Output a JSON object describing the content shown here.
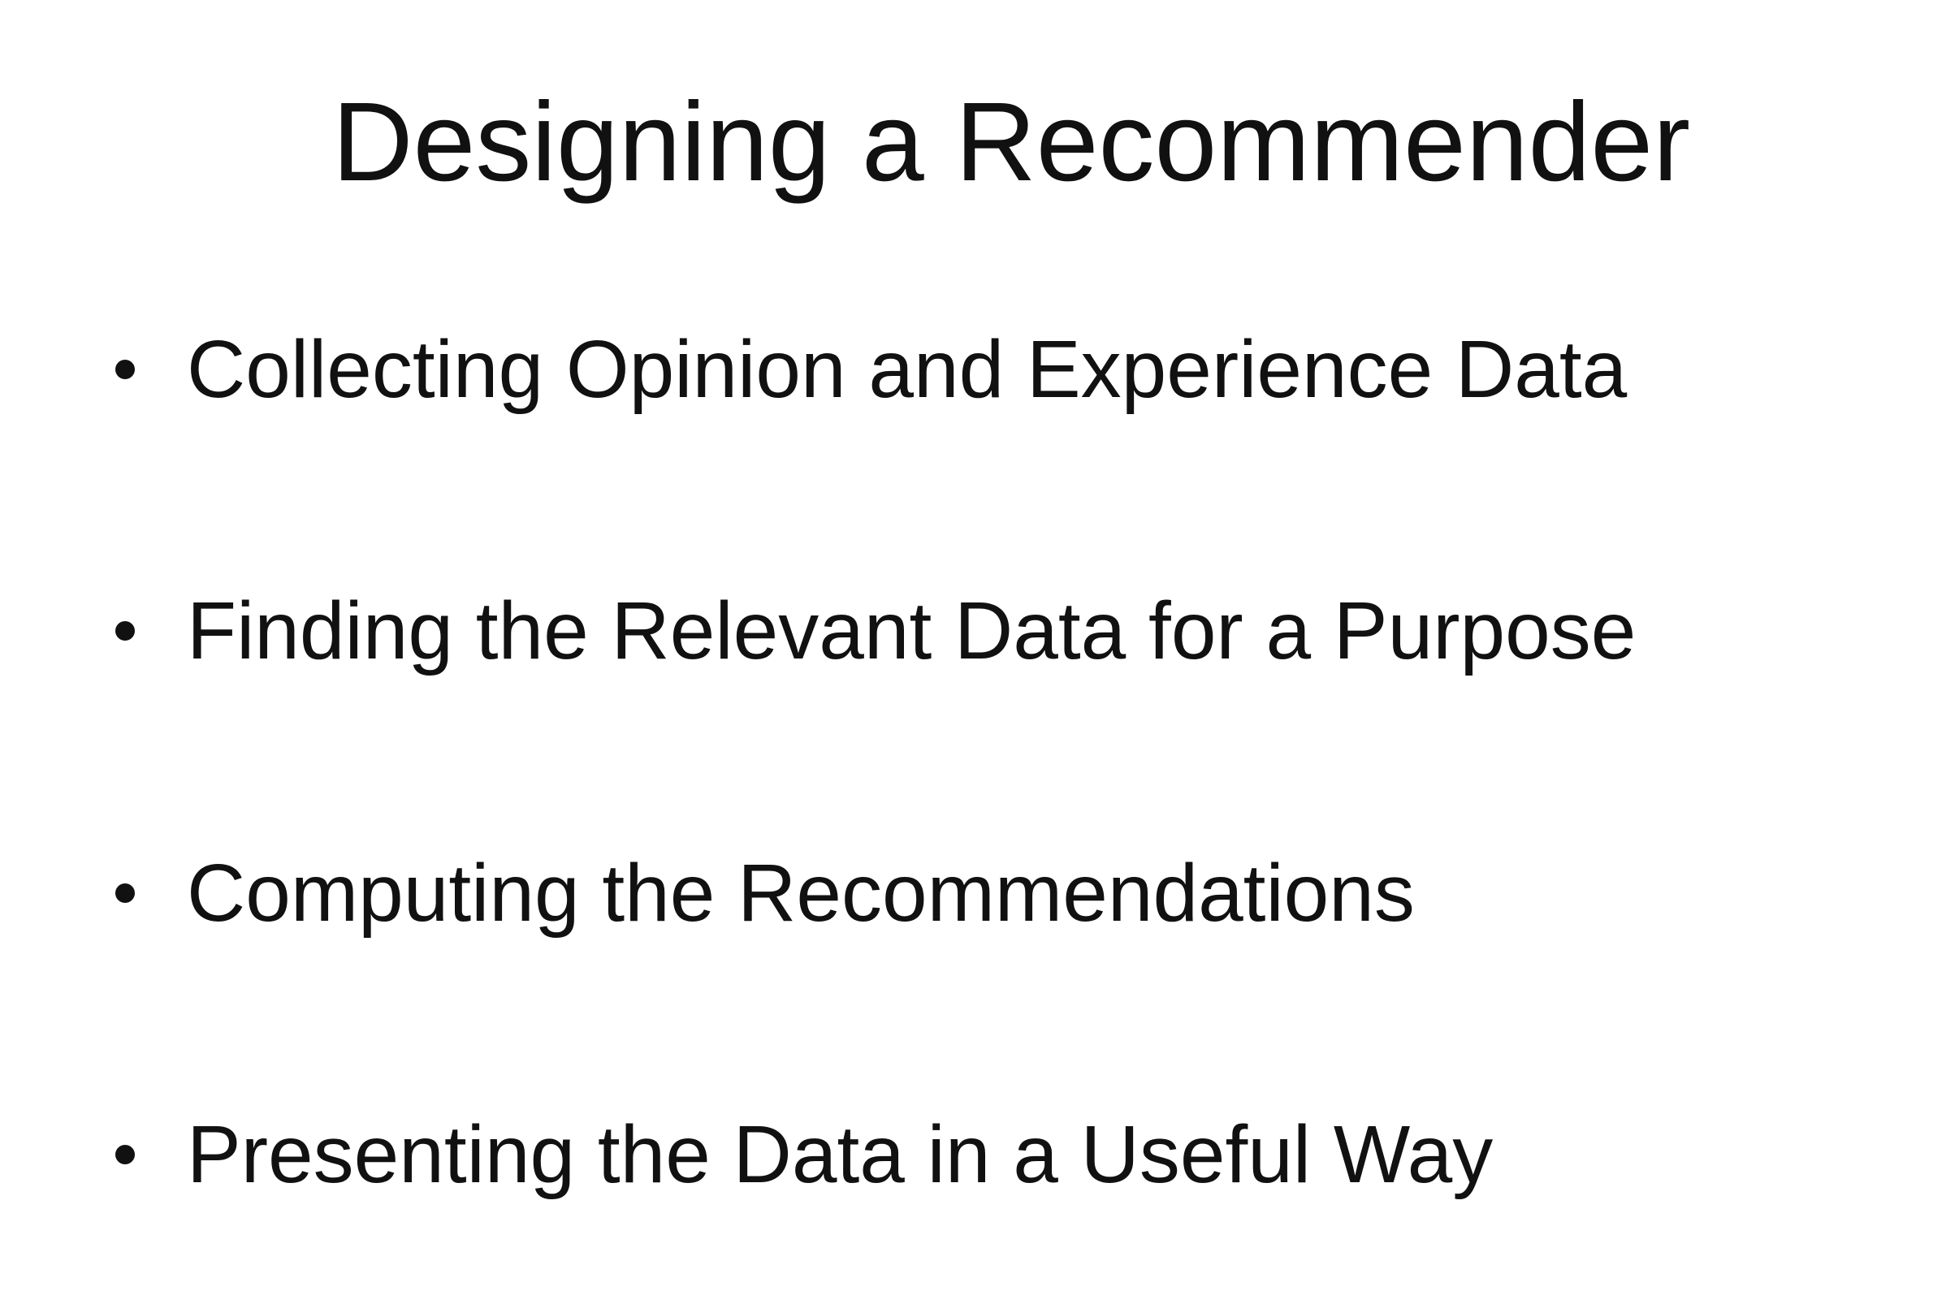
{
  "slide": {
    "title": "Designing a Recommender",
    "bullets": [
      "Collecting Opinion and Experience Data",
      "Finding the Relevant Data for a Purpose",
      "Computing the Recommendations",
      "Presenting the Data in a Useful Way"
    ]
  }
}
